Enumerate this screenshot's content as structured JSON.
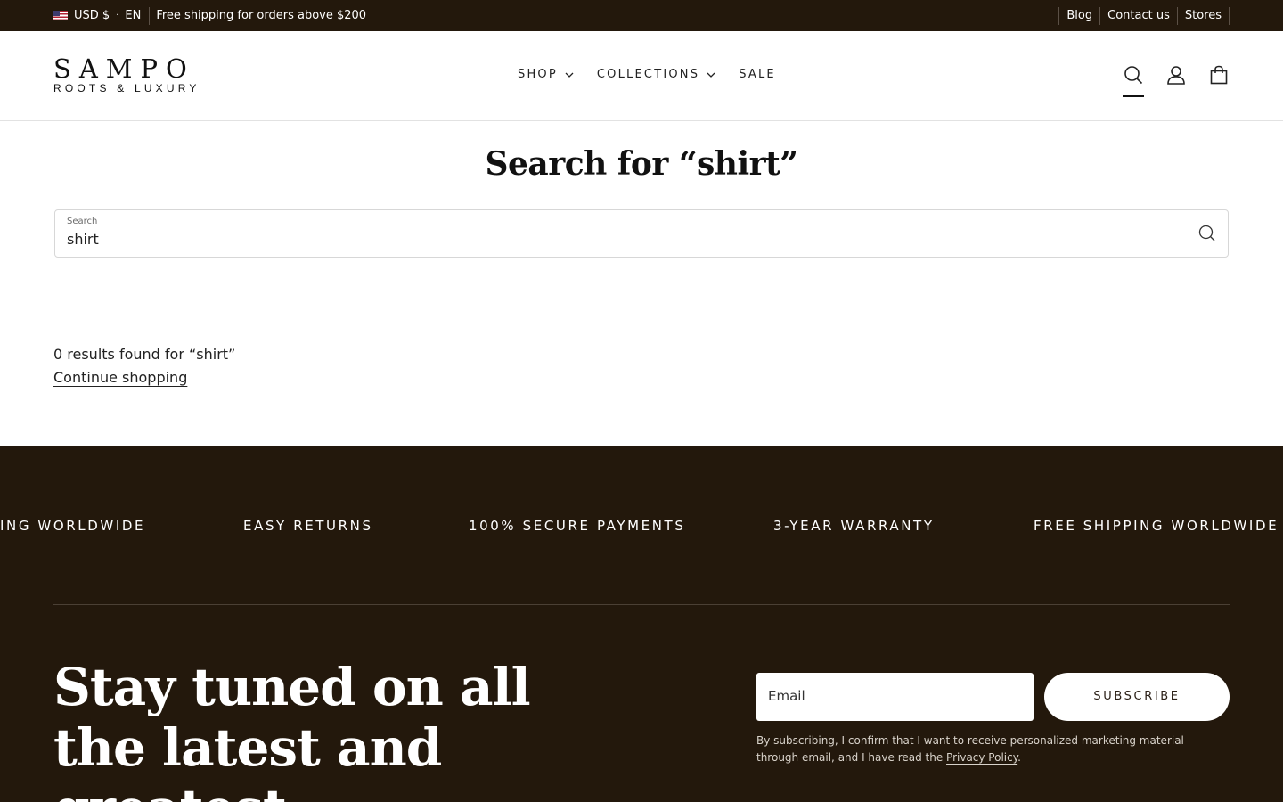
{
  "topbar": {
    "currency": "USD $",
    "language": "EN",
    "shipping_text": "Free shipping for orders above $200",
    "links": [
      "Blog",
      "Contact us",
      "Stores"
    ]
  },
  "header": {
    "brand": "SAMPO",
    "tagline": "ROOTS & LUXURY",
    "nav": [
      "SHOP",
      "COLLECTIONS",
      "SALE"
    ],
    "icons": [
      "search-icon",
      "account-icon",
      "cart-icon"
    ]
  },
  "main": {
    "title": "Search for “shirt”",
    "search_label": "Search",
    "search_value": "shirt",
    "results_text": "0 results found for “shirt”",
    "continue_link": "Continue shopping"
  },
  "footer": {
    "marquee": [
      "ING WORLDWIDE",
      "EASY RETURNS",
      "100% SECURE PAYMENTS",
      "3-YEAR WARRANTY",
      "FREE SHIPPING WORLDWIDE"
    ],
    "heading": "Stay tuned on all the latest and greatest",
    "email_placeholder": "Email",
    "subscribe_label": "SUBSCRIBE",
    "legal_text": "By subscribing, I confirm that I want to receive personalized marketing material through email, and I have read the ",
    "privacy_link": "Privacy Policy",
    "legal_end": "."
  },
  "colors": {
    "dark_brown": "#23180c",
    "white": "#ffffff"
  }
}
